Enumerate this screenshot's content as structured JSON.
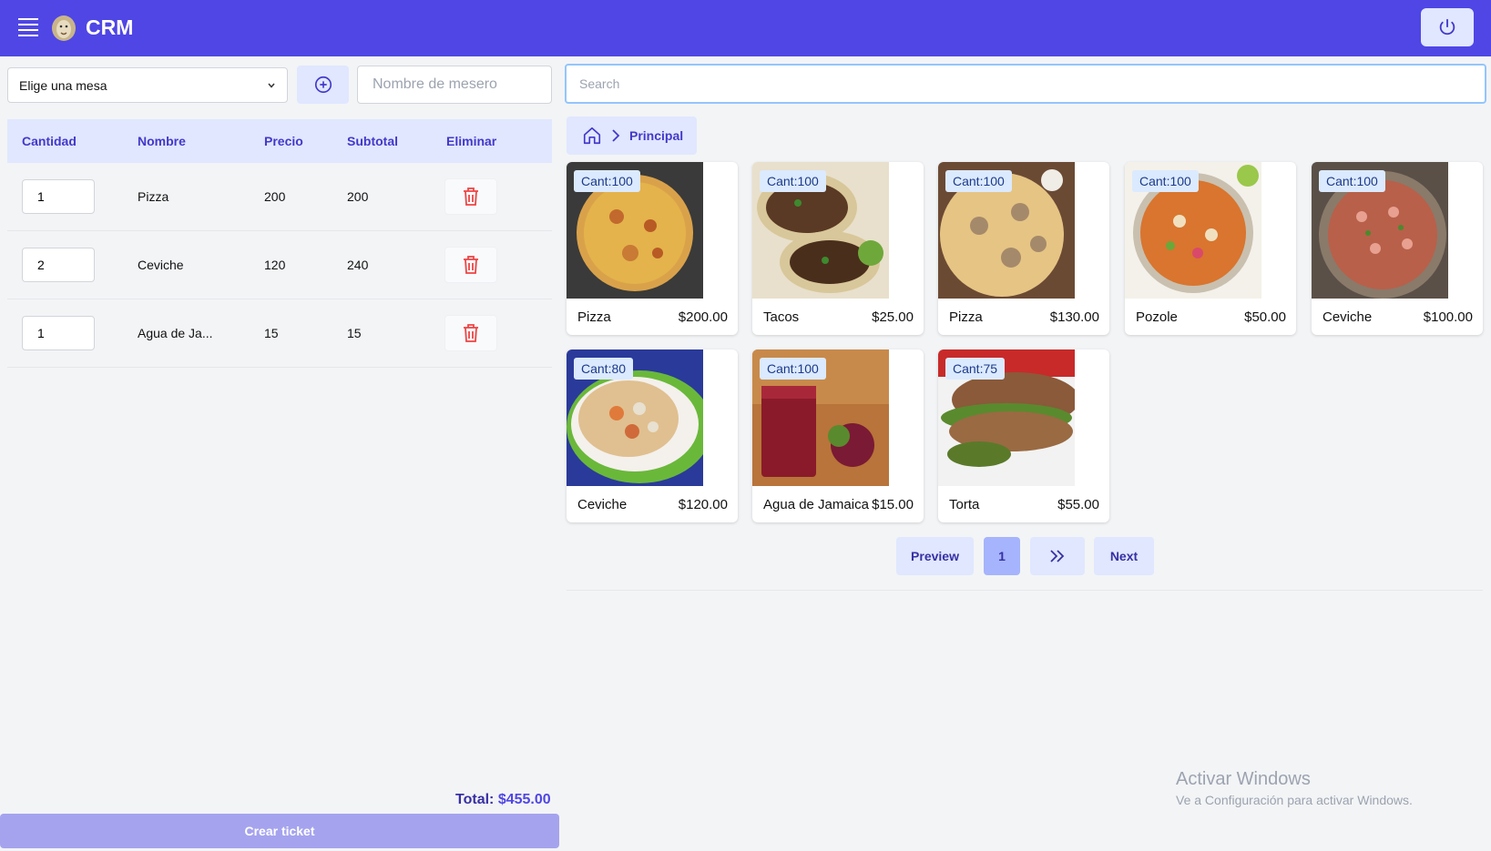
{
  "app": {
    "brand": "CRM"
  },
  "controls": {
    "mesa_select": "Elige una mesa",
    "mesero_placeholder": "Nombre de mesero",
    "search_placeholder": "Search"
  },
  "order": {
    "headers": [
      "Cantidad",
      "Nombre",
      "Precio",
      "Subtotal",
      "Eliminar"
    ],
    "rows": [
      {
        "qty": "1",
        "name": "Pizza",
        "price": "200",
        "subtotal": "200"
      },
      {
        "qty": "2",
        "name": "Ceviche",
        "price": "120",
        "subtotal": "240"
      },
      {
        "qty": "1",
        "name": "Agua de Ja...",
        "price": "15",
        "subtotal": "15"
      }
    ],
    "total_label": "Total:",
    "total_value": "$455.00",
    "create_button": "Crear ticket"
  },
  "breadcrumb": {
    "current": "Principal"
  },
  "products": [
    {
      "badge": "Cant:100",
      "name": "Pizza",
      "price": "$200.00",
      "img": "pizza"
    },
    {
      "badge": "Cant:100",
      "name": "Tacos",
      "price": "$25.00",
      "img": "tacos"
    },
    {
      "badge": "Cant:100",
      "name": "Pizza",
      "price": "$130.00",
      "img": "pizza2"
    },
    {
      "badge": "Cant:100",
      "name": "Pozole",
      "price": "$50.00",
      "img": "pozole"
    },
    {
      "badge": "Cant:100",
      "name": "Ceviche",
      "price": "$100.00",
      "img": "ceviche"
    },
    {
      "badge": "Cant:80",
      "name": "Ceviche",
      "price": "$120.00",
      "img": "tostada"
    },
    {
      "badge": "Cant:100",
      "name": "Agua de Jamaica",
      "price": "$15.00",
      "img": "jamaica"
    },
    {
      "badge": "Cant:75",
      "name": "Torta",
      "price": "$55.00",
      "img": "torta"
    }
  ],
  "pagination": {
    "prev": "Preview",
    "page": "1",
    "next": "Next"
  },
  "watermark": {
    "title": "Activar Windows",
    "subtitle": "Ve a Configuración para activar Windows."
  },
  "colors": {
    "primary": "#4f46e5",
    "accent_light": "#e0e7ff",
    "danger": "#ef4444"
  }
}
